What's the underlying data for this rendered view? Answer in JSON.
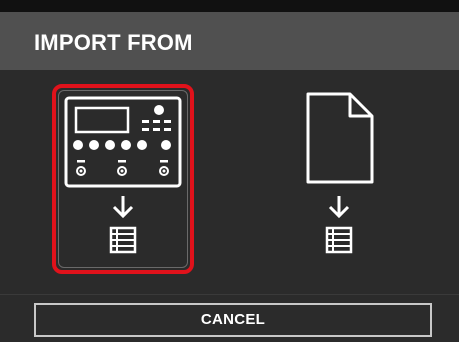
{
  "dialog": {
    "title": "IMPORT FROM",
    "options": [
      {
        "name": "device",
        "icon": "hardware-device-icon",
        "selected": true
      },
      {
        "name": "file",
        "icon": "file-icon",
        "selected": false
      }
    ],
    "cancel_label": "CANCEL"
  },
  "colors": {
    "header_bg": "#505050",
    "panel_bg": "#2b2b2b",
    "selection": "#e0121b",
    "icon": "#ffffff"
  }
}
